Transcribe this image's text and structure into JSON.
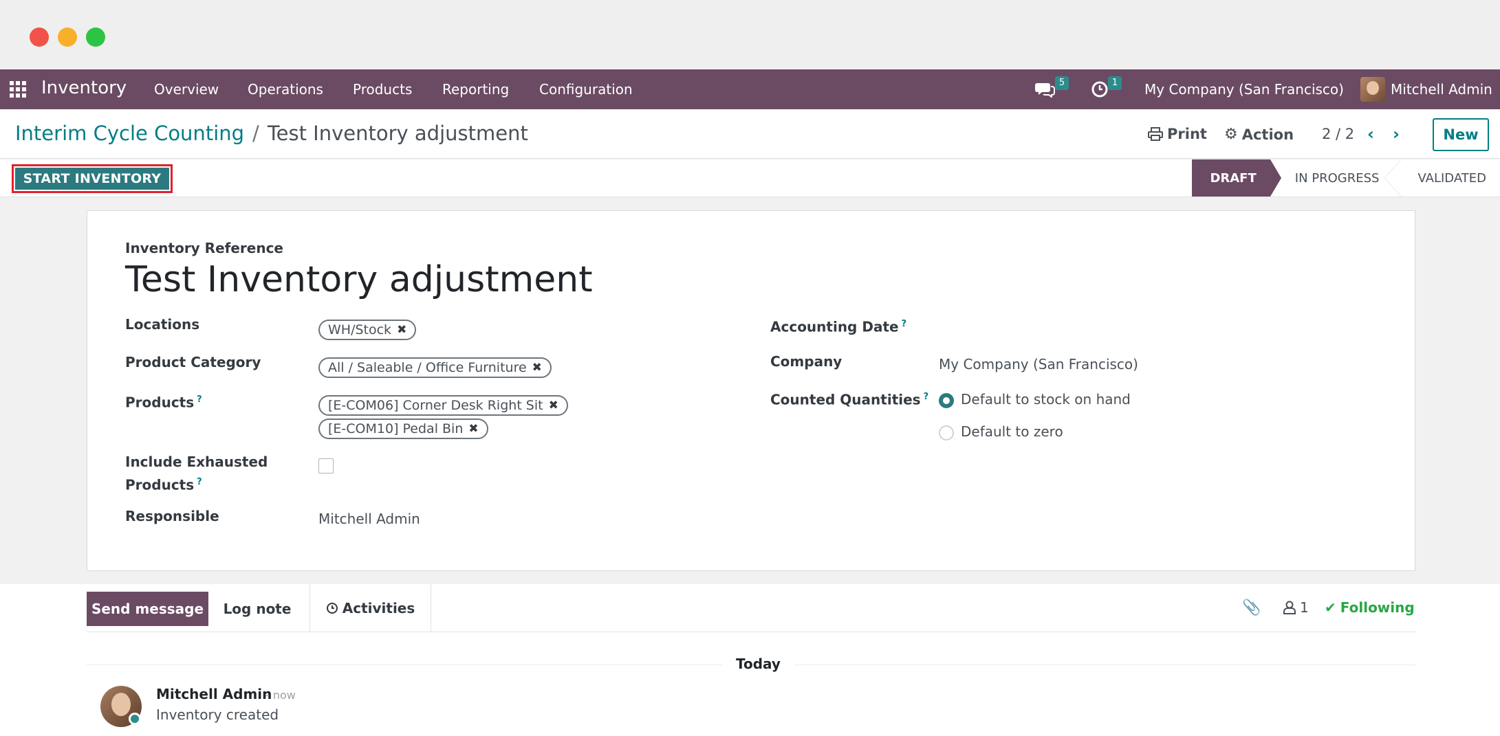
{
  "navbar": {
    "app_name": "Inventory",
    "menu": [
      "Overview",
      "Operations",
      "Products",
      "Reporting",
      "Configuration"
    ],
    "messages_count": "5",
    "activities_count": "1",
    "company": "My Company (San Francisco)",
    "user": "Mitchell Admin",
    "color": "#6b4b63"
  },
  "control": {
    "breadcrumb_parent": "Interim Cycle Counting",
    "breadcrumb_sep": "/",
    "breadcrumb_current": "Test Inventory adjustment",
    "print_label": "Print",
    "action_label": "Action",
    "pager": "2 / 2",
    "new_label": "New"
  },
  "statusbar": {
    "start_label": "START INVENTORY",
    "stages": [
      "DRAFT",
      "IN PROGRESS",
      "VALIDATED"
    ],
    "active_stage": "DRAFT"
  },
  "form": {
    "ref_label": "Inventory Reference",
    "ref_value": "Test Inventory adjustment",
    "locations_label": "Locations",
    "locations": [
      "WH/Stock"
    ],
    "product_category_label": "Product Category",
    "product_category": [
      "All / Saleable / Office Furniture"
    ],
    "products_label": "Products",
    "products": [
      "[E-COM06] Corner Desk Right Sit",
      "[E-COM10] Pedal Bin"
    ],
    "include_exhausted_label_1": "Include Exhausted",
    "include_exhausted_label_2": "Products",
    "include_exhausted": false,
    "responsible_label": "Responsible",
    "responsible": "Mitchell Admin",
    "accounting_date_label": "Accounting Date",
    "company_label": "Company",
    "company": "My Company (San Francisco)",
    "counted_label": "Counted Quantities",
    "counted_options": [
      "Default to stock on hand",
      "Default to zero"
    ],
    "counted_selected": "Default to stock on hand",
    "help_mark": "?"
  },
  "chatter": {
    "send_label": "Send message",
    "log_label": "Log note",
    "activities_label": "Activities",
    "followers": "1",
    "following_label": "Following",
    "date_separator": "Today",
    "message": {
      "author": "Mitchell Admin",
      "time": "- now",
      "body": "Inventory created"
    }
  }
}
